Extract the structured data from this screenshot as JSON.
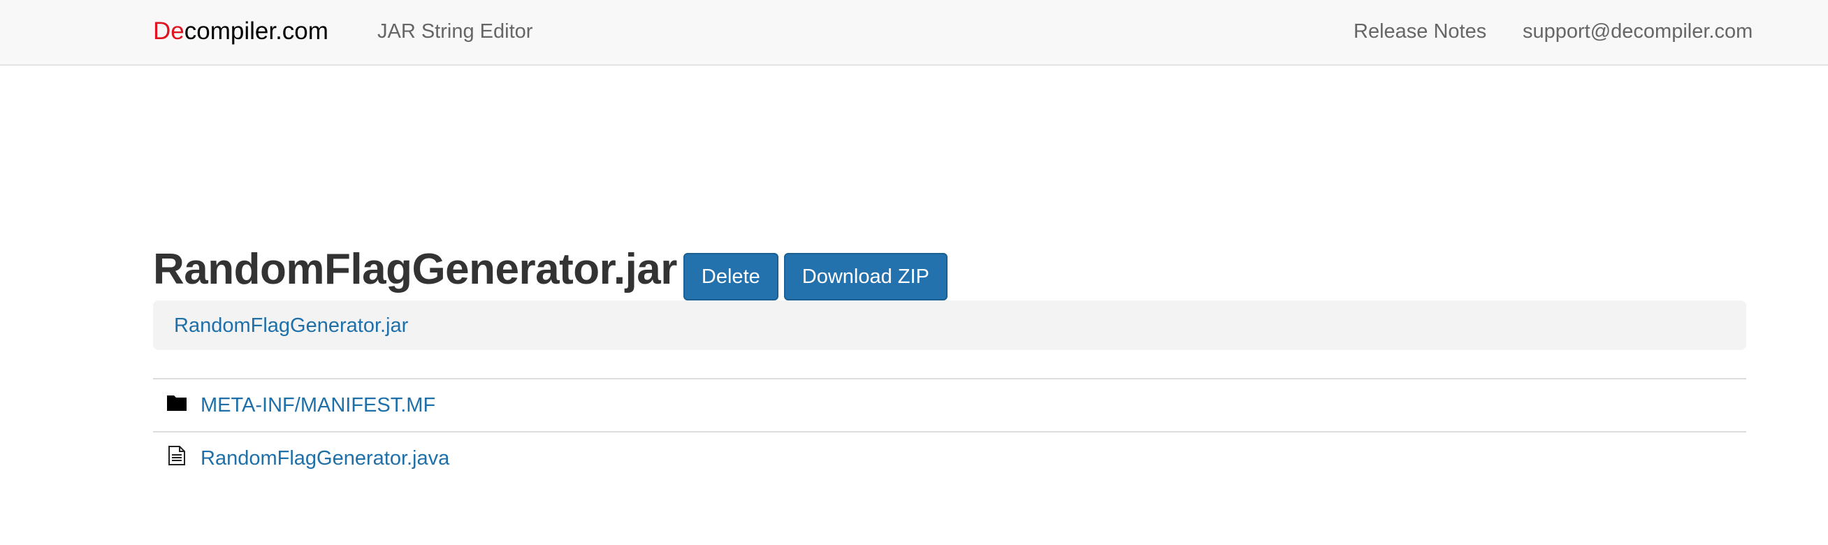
{
  "navbar": {
    "brand_accent": "De",
    "brand_rest": "compiler.com",
    "links": {
      "jar_string_editor": "JAR String Editor",
      "release_notes": "Release Notes",
      "support_email": "support@decompiler.com"
    }
  },
  "main": {
    "title": "RandomFlagGenerator.jar",
    "buttons": {
      "delete": "Delete",
      "download_zip": "Download ZIP"
    },
    "breadcrumb": [
      "RandomFlagGenerator.jar"
    ],
    "files": [
      {
        "name": "META-INF/MANIFEST.MF",
        "icon": "folder-icon"
      },
      {
        "name": "RandomFlagGenerator.java",
        "icon": "file-text-icon"
      }
    ]
  },
  "colors": {
    "brand_accent": "#e0141e",
    "primary_button": "#2371ad",
    "link": "#1f6fa8",
    "navbar_bg": "#f8f8f8",
    "breadcrumb_bg": "#f3f3f3"
  }
}
